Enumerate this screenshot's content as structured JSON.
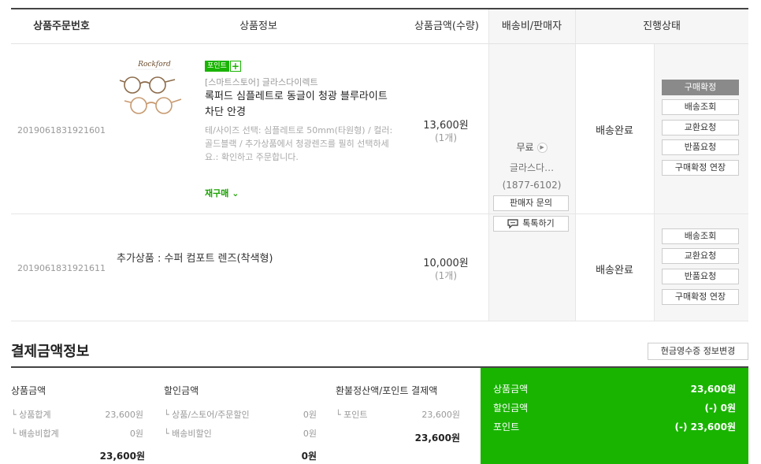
{
  "table": {
    "headers": {
      "order_no": "상품주문번호",
      "product": "상품정보",
      "price": "상품금액(수량)",
      "shipping": "배송비/판매자",
      "status": "진행상태"
    },
    "items": [
      {
        "order_no": "2019061831921601",
        "badge": "포인트",
        "badge_plus": "+",
        "store": "[스마트스토어] 글라스다이렉트",
        "name": "록퍼드 심플레트로 동글이 청광 블루라이트 차단 안경",
        "option": "테/사이즈 선택: 심플레트로 50mm(타원형) / 컬러: 골드블랙 / 추가상품에서 청광렌즈를 필히 선택하세요.: 확인하고 주문합니다.",
        "rebuy": "재구매 ⌄",
        "price": "13,600원",
        "qty": "(1개)",
        "status": "배송완료",
        "actions": [
          "구매확정",
          "배송조회",
          "교환요청",
          "반품요청",
          "구매확정 연장"
        ]
      },
      {
        "order_no": "2019061831921611",
        "name": "추가상품 : 수퍼 컴포트 렌즈(착색형)",
        "price": "10,000원",
        "qty": "(1개)",
        "status": "배송완료",
        "actions": [
          "배송조회",
          "교환요청",
          "반품요청",
          "구매확정 연장"
        ]
      }
    ],
    "shipping": {
      "fee": "무료",
      "fee_arrow": "▶",
      "seller": "글라스다…",
      "phone": "(1877-6102)",
      "inquiry_button": "판매자 문의",
      "talk_button": "톡톡하기"
    }
  },
  "payment": {
    "title": "결제금액정보",
    "receipt_button": "현금영수증 정보변경",
    "product_amount": {
      "label": "상품금액",
      "rows": [
        {
          "label": "└ 상품합계",
          "value": "23,600원"
        },
        {
          "label": "└ 배송비합계",
          "value": "0원"
        }
      ],
      "total": "23,600원"
    },
    "discount_amount": {
      "label": "할인금액",
      "rows": [
        {
          "label": "└ 상품/스토어/주문할인",
          "value": "0원"
        },
        {
          "label": "└ 배송비할인",
          "value": "0원"
        }
      ],
      "total": "0원"
    },
    "refund": {
      "label": "환불정산액/포인트 결제액",
      "rows": [
        {
          "label": "└ 포인트",
          "value": "23,600원"
        }
      ],
      "total": "23,600원"
    },
    "summary": {
      "product_label": "상품금액",
      "product_value": "23,600원",
      "discount_label": "할인금액",
      "discount_value": "(-) 0원",
      "point_label": "포인트",
      "point_value": "(-) 23,600원"
    }
  },
  "colors": {
    "accent_green": "#19b400",
    "primary_button": "#8a8a8a"
  }
}
